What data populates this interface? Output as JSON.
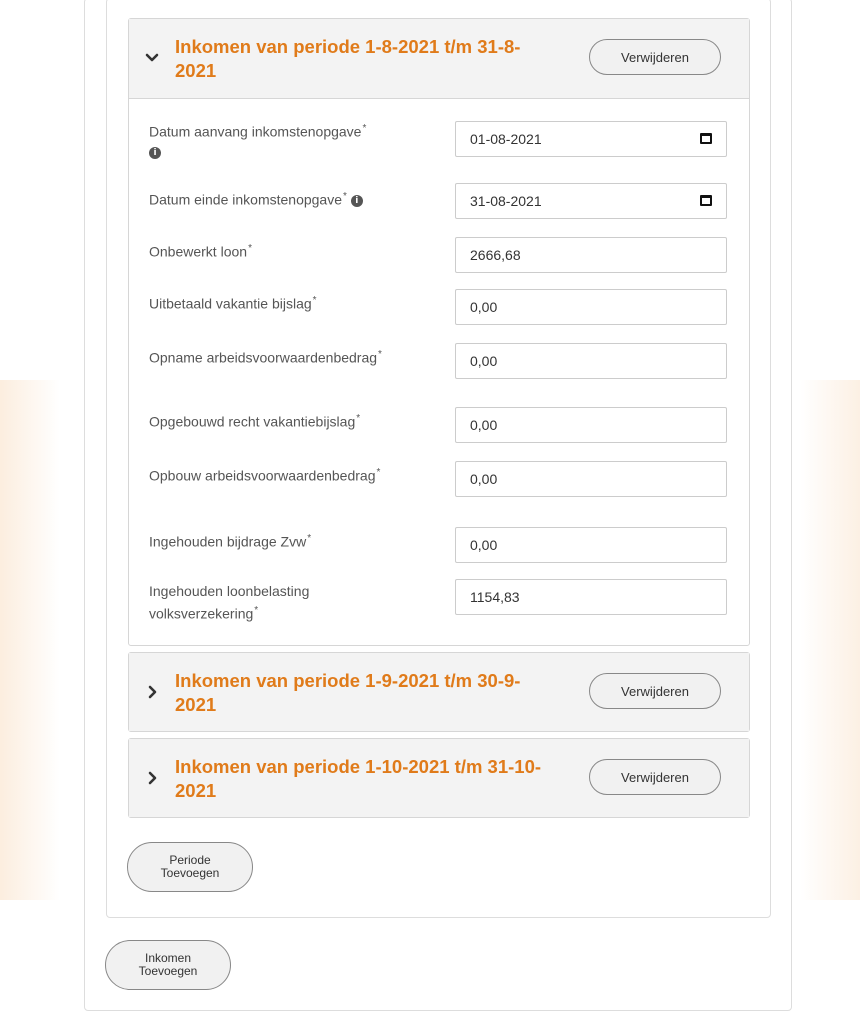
{
  "panels": [
    {
      "title": "Inkomen van periode 1-8-2021 t/m 31-8-2021",
      "remove_label": "Verwijderen",
      "expanded": true
    },
    {
      "title": "Inkomen van periode 1-9-2021 t/m 30-9-2021",
      "remove_label": "Verwijderen",
      "expanded": false
    },
    {
      "title": "Inkomen van periode 1-10-2021 t/m 31-10-2021",
      "remove_label": "Verwijderen",
      "expanded": false
    }
  ],
  "form": {
    "fields": [
      {
        "label": "Datum aanvang inkomstenopgave",
        "value": "01-08-2021",
        "type": "date"
      },
      {
        "label": "Datum einde inkomstenopgave",
        "value": "31-08-2021",
        "type": "date"
      },
      {
        "label": "Onbewerkt loon",
        "value": "2666,68",
        "type": "text"
      },
      {
        "label": "Uitbetaald vakantie bijslag",
        "value": "0,00",
        "type": "text"
      },
      {
        "label": "Opname arbeidsvoorwaardenbedrag",
        "value": "0,00",
        "type": "text"
      },
      {
        "label": "Opgebouwd recht vakantiebijslag",
        "value": "0,00",
        "type": "text"
      },
      {
        "label": "Opbouw arbeidsvoorwaardenbedrag",
        "value": "0,00",
        "type": "text"
      },
      {
        "label": "Ingehouden bijdrage Zvw",
        "value": "0,00",
        "type": "text"
      },
      {
        "label": "Ingehouden loonbelasting volksverzekering",
        "value": "1154,83",
        "type": "text"
      }
    ],
    "required_marker": "*"
  },
  "buttons": {
    "add_period": "Periode Toevoegen",
    "add_income": "Inkomen Toevoegen"
  },
  "colors": {
    "accent": "#e07b1a"
  },
  "icons": {
    "expanded": "chevron-down-icon",
    "collapsed": "chevron-right-icon",
    "info": "info-icon",
    "calendar": "calendar-icon"
  }
}
